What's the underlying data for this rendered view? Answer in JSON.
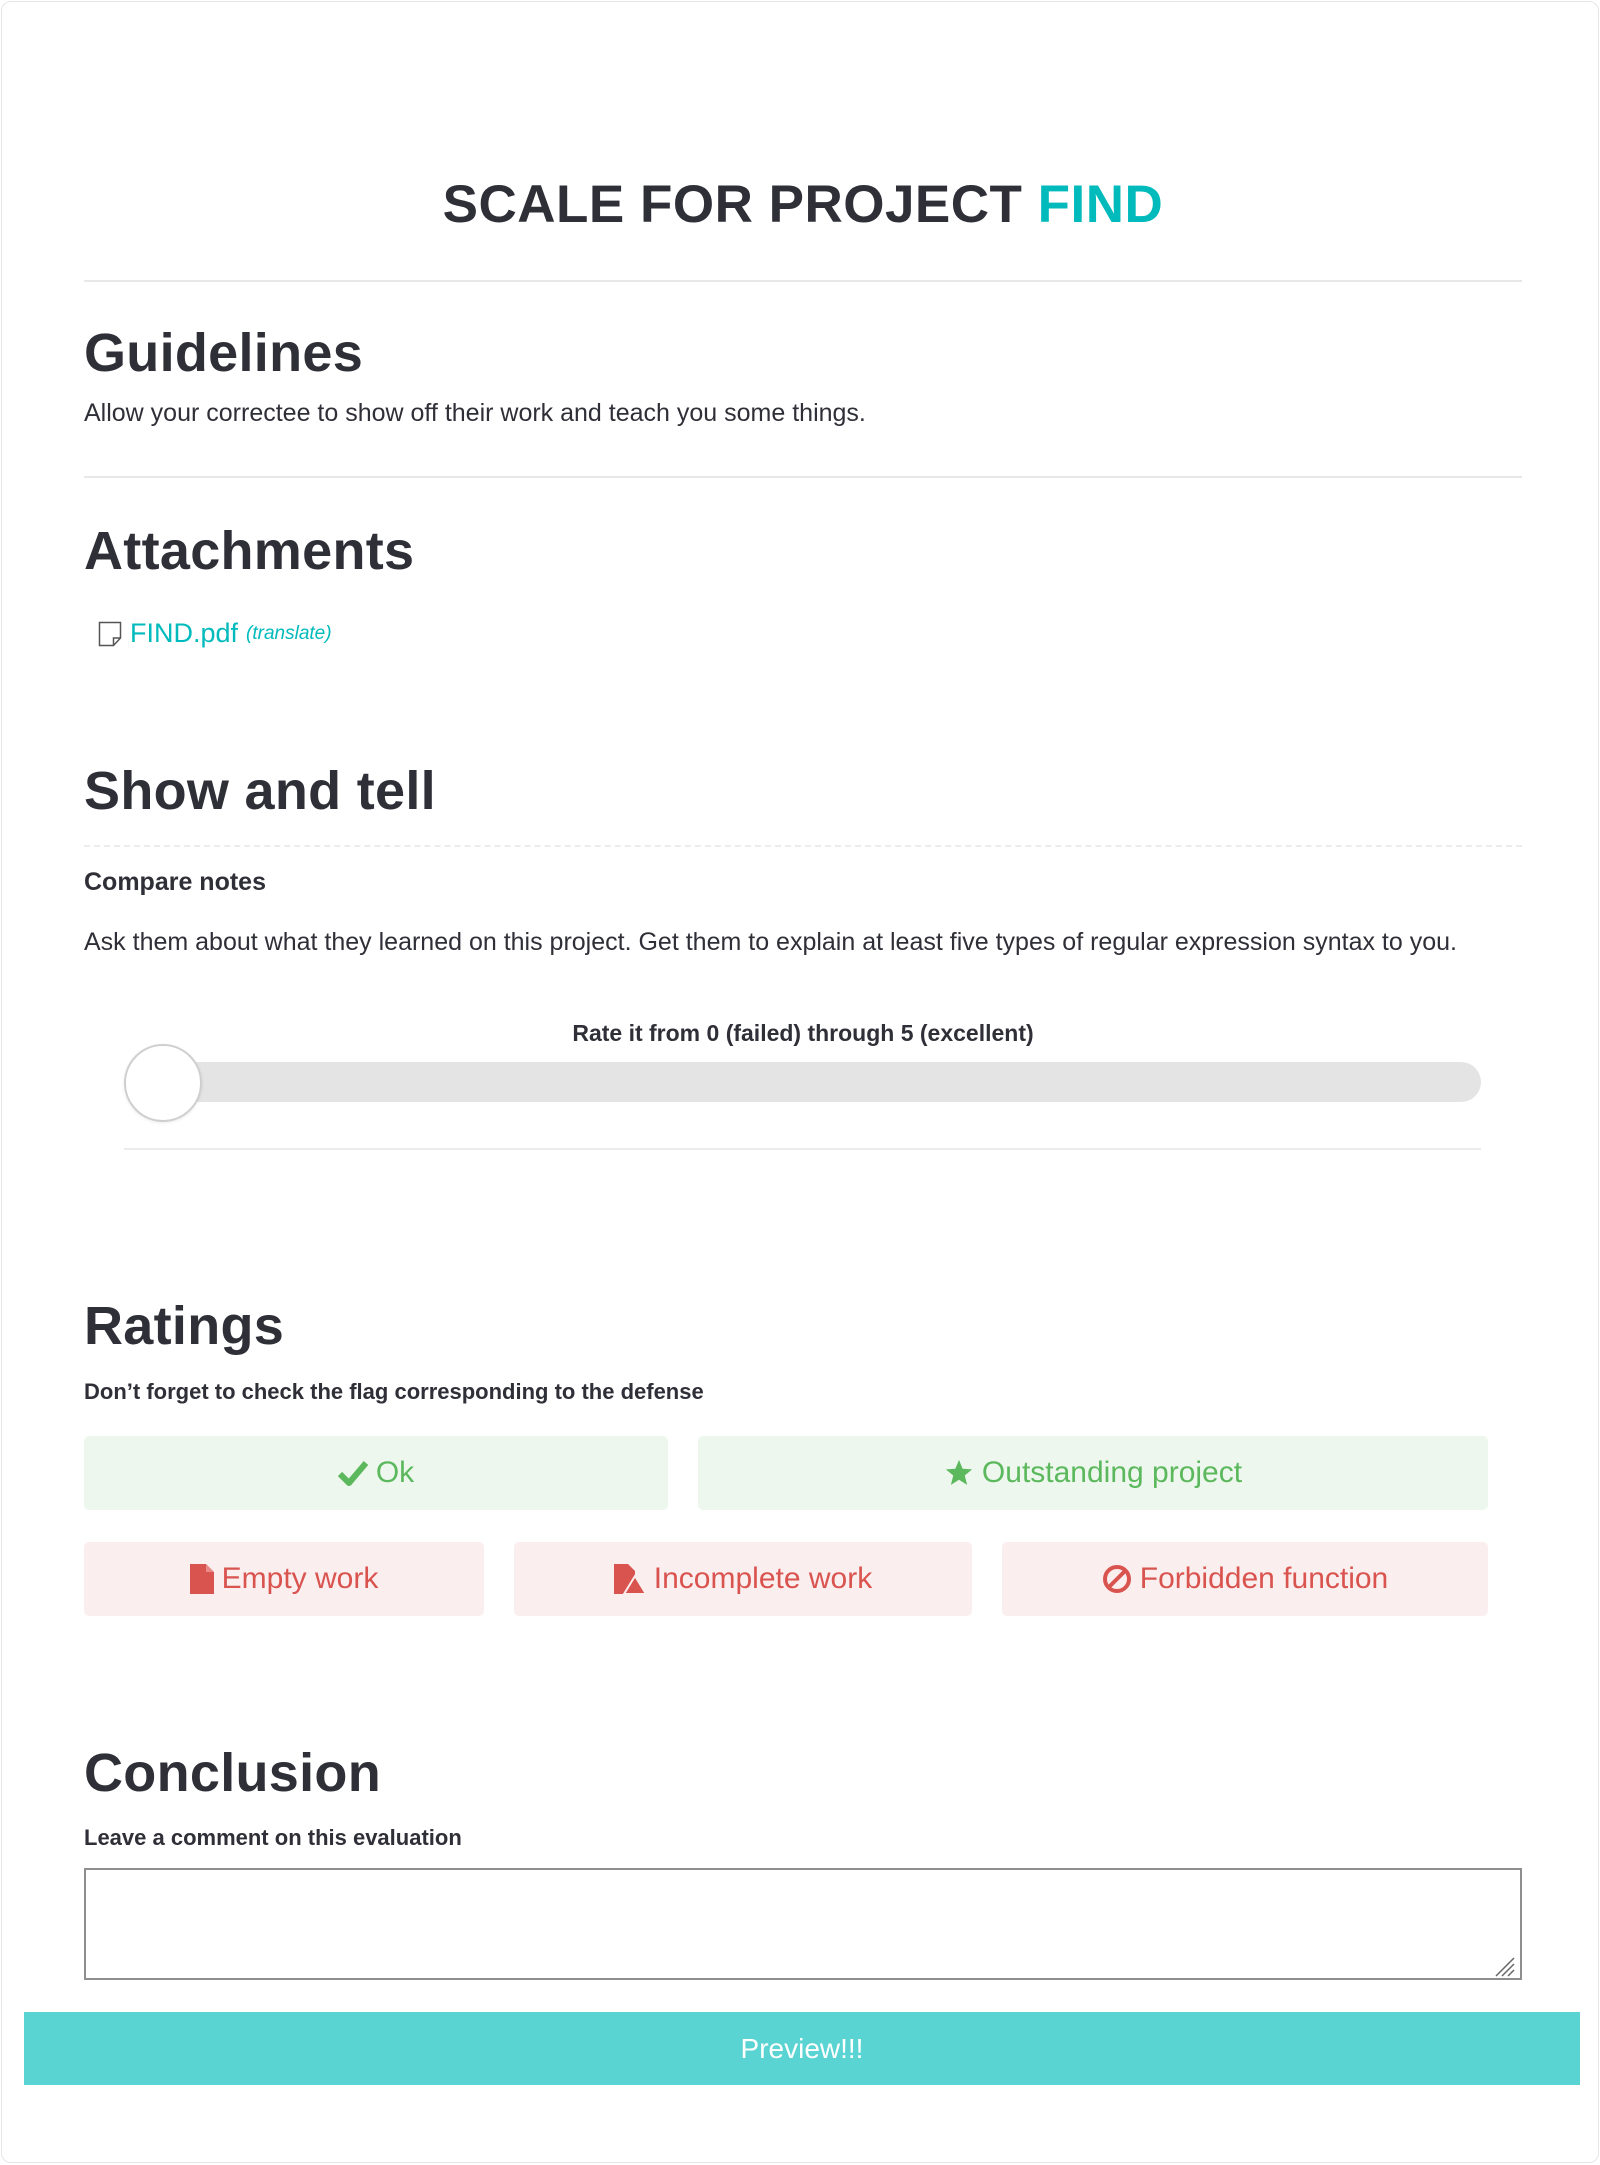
{
  "title": {
    "prefix": "SCALE FOR PROJECT",
    "project": "FIND"
  },
  "guidelines": {
    "heading": "Guidelines",
    "text": "Allow your correctee to show off their work and teach you some things."
  },
  "attachments": {
    "heading": "Attachments",
    "items": [
      {
        "name": "FIND.pdf",
        "translate_label": "(translate)",
        "icon": "file-icon"
      }
    ]
  },
  "section": {
    "heading": "Show and tell",
    "question": {
      "title": "Compare notes",
      "text": "Ask them about what they learned on this project. Get them to explain at least five types of regular expression syntax to you.",
      "rate_label": "Rate it from 0 (failed) through 5 (excellent)",
      "rating_value": 0,
      "rating_max": 5
    }
  },
  "ratings": {
    "heading": "Ratings",
    "subtitle": "Don’t forget to check the flag corresponding to the defense",
    "positive": [
      {
        "label": "Ok",
        "icon": "check-icon"
      },
      {
        "label": "Outstanding project",
        "icon": "star-icon"
      }
    ],
    "negative": [
      {
        "label": "Empty work",
        "icon": "file-icon"
      },
      {
        "label": "Incomplete work",
        "icon": "file-warning-icon"
      },
      {
        "label": "Forbidden function",
        "icon": "ban-icon"
      }
    ],
    "colors": {
      "positive": "#5cb85c",
      "negative": "#d9534f",
      "accent": "#00babc",
      "button": "#5ad3d3"
    }
  },
  "conclusion": {
    "heading": "Conclusion",
    "subtitle": "Leave a comment on this evaluation",
    "comment_value": ""
  },
  "preview_button": {
    "label": "Preview!!!"
  }
}
